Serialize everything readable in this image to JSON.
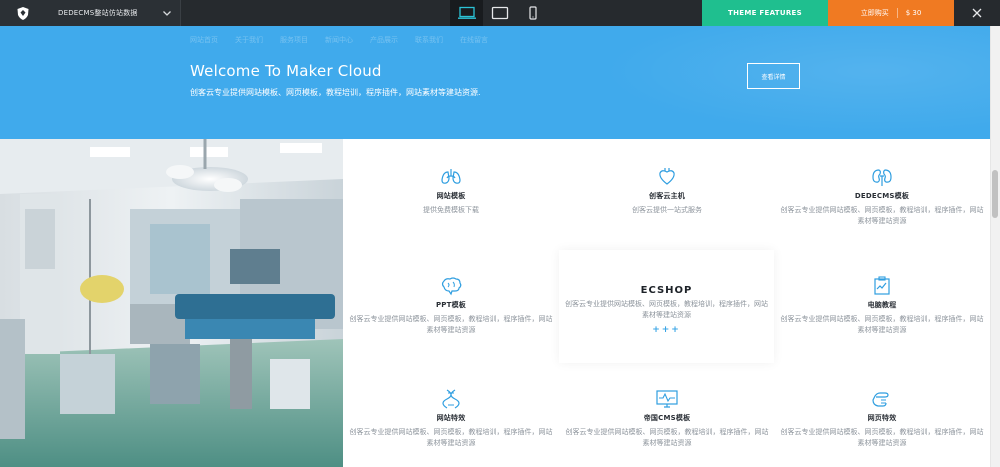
{
  "demo_bar": {
    "brand_name": "DEDECMS整站仿站数据",
    "devices": [
      "desktop-icon",
      "tablet-icon",
      "phone-icon"
    ],
    "features_label": "THEME FEATURES",
    "buy_label": "立即购买",
    "price": "$ 30",
    "colors": {
      "bar": "#262a2e",
      "features": "#1fbf8f",
      "buy": "#f07a22"
    }
  },
  "hero": {
    "nav": [
      "网站首页",
      "关于我们",
      "服务项目",
      "新闻中心",
      "产品展示",
      "联系我们",
      "在线留言"
    ],
    "title": "Welcome To Maker Cloud",
    "subtitle": "创客云专业提供网站模板、网页模板，教程培训，程序插件，网站素材等建站资源.",
    "button_label": "查看详情",
    "color": "#40aaec"
  },
  "services": {
    "items": [
      {
        "icon": "lungs-icon",
        "title": "网站模板",
        "desc": "提供免费模板下载"
      },
      {
        "icon": "heart-icon",
        "title": "创客云主机",
        "desc": "创客云提供一站式服务"
      },
      {
        "icon": "kidneys-icon",
        "title": "DEDECMS模板",
        "desc": "创客云专业提供网站模板、网页模板，教程培训，程序插件，网站素材等建站资源"
      },
      {
        "icon": "brain-icon",
        "title": "PPT模板",
        "desc": "创客云专业提供网站模板、网页模板，教程培训，程序插件，网站素材等建站资源"
      },
      {
        "icon": "clipboard-icon",
        "title": "电脑教程",
        "desc": "创客云专业提供网站模板、网页模板，教程培训，程序插件，网站素材等建站资源"
      },
      {
        "icon": "dna-icon",
        "title": "网站特效",
        "desc": "创客云专业提供网站模板、网页模板，教程培训，程序插件，网站素材等建站资源"
      },
      {
        "icon": "monitor-pulse-icon",
        "title": "帝国CMS模板",
        "desc": "创客云专业提供网站模板、网页模板，教程培训，程序插件，网站素材等建站资源"
      },
      {
        "icon": "hand-pointer-icon",
        "title": "网页特效",
        "desc": "创客云专业提供网站模板、网页模板，教程培训，程序插件，网站素材等建站资源"
      }
    ],
    "feature": {
      "title": "ECSHOP",
      "desc": "创客云专业提供网站模板、网页模板，教程培训，程序插件，网站素材等建站资源",
      "plus": "+++"
    },
    "accent_color": "#3aa5e6"
  }
}
